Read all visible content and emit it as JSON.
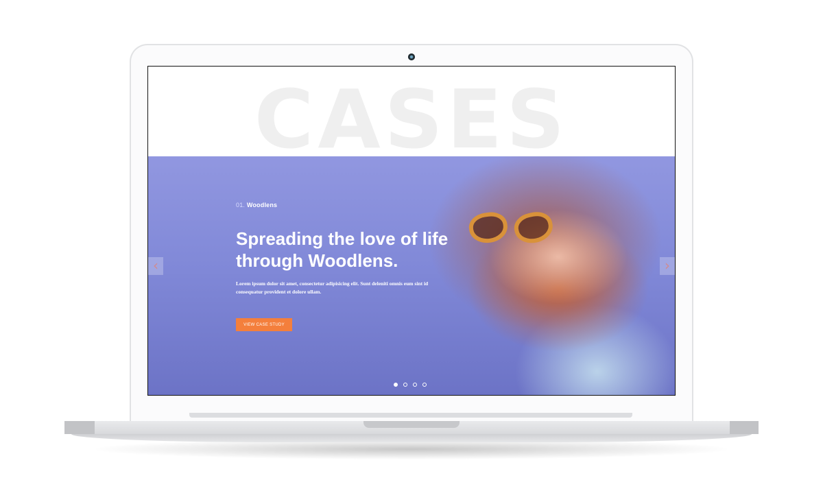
{
  "screen": {
    "watermark": "CASES",
    "case_number": "01.",
    "case_name": "Woodlens",
    "headline": "Spreading the love of life through Woodlens.",
    "body": "Lorem ipsum dolor sit amet, consectetur adipisicing elit. Sunt deleniti omnis eum sint id consequatur provident et dolore ullam.",
    "cta_label": "VIEW CASE STUDY",
    "prev_arrow": "‹",
    "next_arrow": "›",
    "slides_total": 4,
    "active_slide": 1
  },
  "colors": {
    "hero_background": "#8a90dc",
    "cta_background": "#f47f3c",
    "watermark": "#efefef"
  },
  "icons": {
    "prev": "chevron-left-icon",
    "next": "chevron-right-icon",
    "camera": "webcam-icon"
  }
}
